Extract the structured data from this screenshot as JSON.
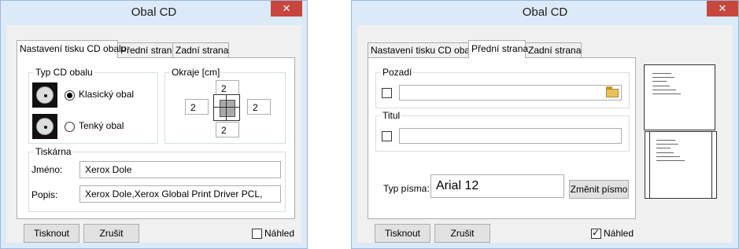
{
  "left_dialog": {
    "title": "Obal CD",
    "close_glyph": "✕",
    "tabs": [
      "Nastavení tisku CD obalu",
      "Přední strana",
      "Zadní strana"
    ],
    "active_tab": "Nastavení tisku CD obalu",
    "cd_type_group": "Typ CD obalu",
    "radio_classic": "Klasický obal",
    "radio_thin": "Tenký obal",
    "selected_cd_type": "Klasický obal",
    "margins_group": "Okraje [cm]",
    "margins": {
      "top": "2",
      "left": "2",
      "right": "2",
      "bottom": "2"
    },
    "printer_group": "Tiskárna",
    "name_label": "Jméno:",
    "name_value": "Xerox Dole",
    "desc_label": "Popis:",
    "desc_value": "Xerox Dole,Xerox Global Print Driver PCL,",
    "print_button": "Tisknout",
    "cancel_button": "Zrušit",
    "preview_label": "Náhled",
    "preview_checked": false
  },
  "right_dialog": {
    "title": "Obal CD",
    "close_glyph": "✕",
    "tabs": [
      "Nastavení tisku CD obalu",
      "Přední strana",
      "Zadní strana"
    ],
    "active_tab": "Přední strana",
    "background_group": "Pozadí",
    "background_value": "",
    "title_group": "Titul",
    "title_value": "",
    "font_label": "Typ písma:",
    "font_value": "Arial 12",
    "change_font_button": "Změnit písmo",
    "print_button": "Tisknout",
    "cancel_button": "Zrušit",
    "preview_label": "Náhled",
    "preview_checked": true
  },
  "icons": {
    "cd_case": "cd-case-icon",
    "margins": "page-margins-icon",
    "open_folder": "folder-open-icon",
    "close": "close-icon",
    "check": "checkmark-icon"
  },
  "colors": {
    "window_frame": "#dce9f7",
    "close_button": "#c7463d",
    "client_bg": "#f0f0f0",
    "panel_bg": "#ffffff"
  }
}
